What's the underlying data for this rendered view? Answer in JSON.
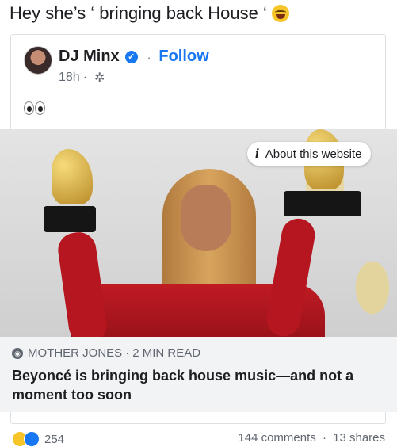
{
  "post": {
    "caption": "Hey she’s ‘ bringing back House ‘",
    "caption_emoji": "laughing-tears-emoji"
  },
  "shared_post": {
    "author": "DJ Minx",
    "verified_icon": "verified-badge-icon",
    "separator": "·",
    "follow_label": "Follow",
    "time": "18h",
    "time_separator": "·",
    "privacy_icon": "gear-icon",
    "body_emoji": "eyes-emoji"
  },
  "link_preview": {
    "about_label": "About this website",
    "source": "MOTHER JONES",
    "read_time": "2 MIN READ",
    "source_separator": "·",
    "headline": "Beyoncé is bringing back house music—and not a moment too soon"
  },
  "footer": {
    "reaction_count": "254",
    "comments": "144 comments",
    "shares": "13 shares",
    "separator": "·"
  },
  "colors": {
    "accent": "#1877f2",
    "meta_text": "#606770",
    "preview_bg": "#f2f3f5"
  }
}
